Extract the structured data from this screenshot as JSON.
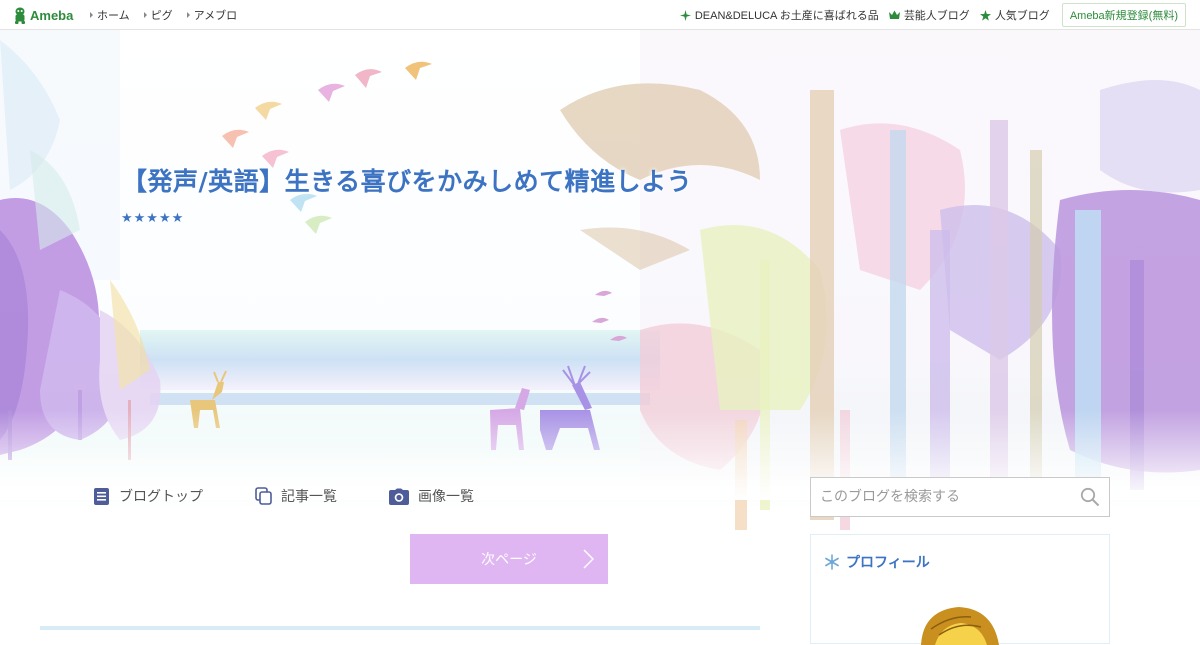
{
  "header": {
    "logo_text": "Ameba",
    "nav": [
      {
        "label": "ホーム"
      },
      {
        "label": "ピグ"
      },
      {
        "label": "アメブロ"
      }
    ],
    "links": [
      {
        "label": "DEAN&DELUCA お土産に喜ばれる品",
        "icon": "sparkle-icon"
      },
      {
        "label": "芸能人ブログ",
        "icon": "crown-icon"
      },
      {
        "label": "人気ブログ",
        "icon": "star-icon"
      }
    ],
    "register_label": "Ameba新規登録(無料)"
  },
  "blog": {
    "title": "【発声/英語】生きる喜びをかみしめて精進しよう",
    "description": "★★★★★"
  },
  "subnav": [
    {
      "label": "ブログトップ",
      "icon": "document-icon"
    },
    {
      "label": "記事一覧",
      "icon": "copy-icon"
    },
    {
      "label": "画像一覧",
      "icon": "camera-icon"
    }
  ],
  "pager": {
    "next_label": "次ページ"
  },
  "search": {
    "placeholder": "このブログを検索する"
  },
  "profile": {
    "heading": "プロフィール"
  },
  "colors": {
    "brand_green": "#2d8c3c",
    "title_blue": "#3c73c2",
    "next_button": "#dfb6f2"
  }
}
